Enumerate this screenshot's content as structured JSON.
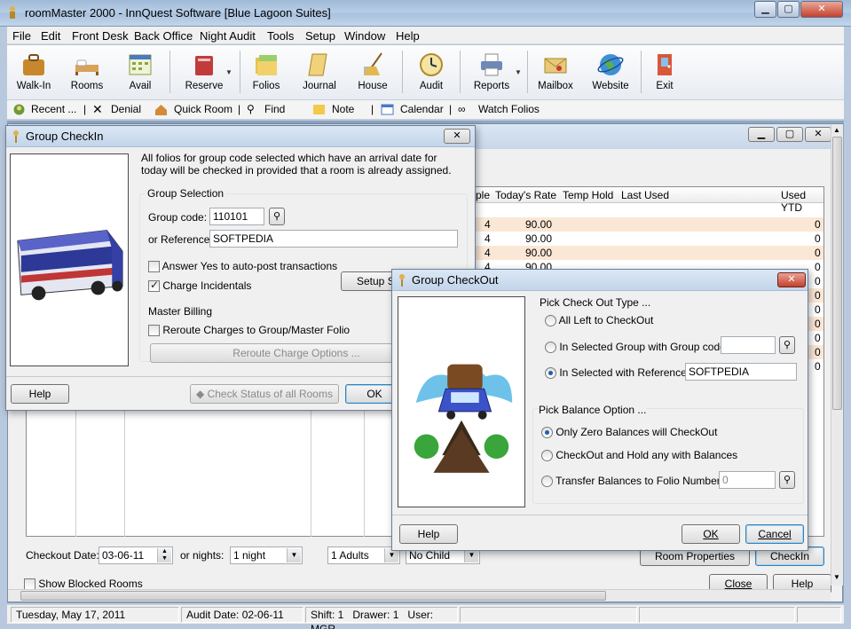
{
  "window": {
    "title": "roomMaster 2000 - InnQuest Software [Blue Lagoon Suites]"
  },
  "menu": [
    "File",
    "Edit",
    "Front Desk",
    "Back Office",
    "Night Audit",
    "Tools",
    "Setup",
    "Window",
    "Help"
  ],
  "toolbar": {
    "walkin": "Walk-In",
    "rooms": "Rooms",
    "avail": "Avail",
    "reserve": "Reserve",
    "folios": "Folios",
    "journal": "Journal",
    "house": "House",
    "audit": "Audit",
    "reports": "Reports",
    "mailbox": "Mailbox",
    "website": "Website",
    "exit": "Exit"
  },
  "toolbar2": {
    "recent": "Recent ...",
    "denial": "Denial",
    "quickroom": "Quick Room",
    "find": "Find",
    "note": "Note",
    "calendar": "Calendar",
    "watchfolios": "Watch Folios"
  },
  "roomgrid": {
    "headers": {
      "people": "ple",
      "rate": "Today's Rate",
      "hold": "Temp Hold",
      "lastused": "Last Used",
      "usedytd": "Used YTD"
    },
    "rows": [
      {
        "people": "4",
        "rate": "90.00",
        "ytd": "0"
      },
      {
        "people": "4",
        "rate": "90.00",
        "ytd": "0"
      },
      {
        "people": "4",
        "rate": "90.00",
        "ytd": "0"
      },
      {
        "people": "4",
        "rate": "90.00",
        "ytd": "0"
      }
    ],
    "extra_ytd": [
      "0",
      "0",
      "0",
      "0",
      "0",
      "0",
      "0"
    ]
  },
  "bottom": {
    "checkout_date_label": "Checkout Date:",
    "checkout_date": "03-06-11",
    "nights_label": "or nights:",
    "nights": "1 night",
    "adults": "1 Adults",
    "child": "No Child",
    "room_properties": "Room Properties",
    "checkin": "CheckIn",
    "show_blocked": "Show Blocked Rooms",
    "close": "Close",
    "help": "Help"
  },
  "checkin_dialog": {
    "title": "Group CheckIn",
    "info": "All folios for group code selected which have an arrival date for today will be checked in provided that a room is already assigned.",
    "group_selection": "Group Selection",
    "group_code_label": "Group code:",
    "group_code": "110101",
    "reference_label": "or Reference:",
    "reference": "SOFTPEDIA",
    "answer_yes": "Answer Yes to auto-post transactions",
    "charge_incidentals": "Charge Incidentals",
    "setup_btn": "Setup S",
    "master_billing": "Master Billing",
    "reroute_charges": "Reroute Charges to Group/Master Folio",
    "reroute_options": "Reroute Charge Options ...",
    "help": "Help",
    "check_status": "Check Status of all Rooms",
    "ok": "OK",
    "close_glyph": "✕"
  },
  "checkout_dialog": {
    "title": "Group CheckOut",
    "pick_type": "Pick Check Out Type ...",
    "all_left": "All Left to CheckOut",
    "in_group": "In Selected Group with Group code:",
    "group_code": "",
    "in_reference": "In Selected with Reference",
    "reference": "SOFTPEDIA",
    "pick_balance": "Pick Balance Option ...",
    "only_zero": "Only Zero Balances will CheckOut",
    "hold_any": "CheckOut and Hold any with Balances",
    "transfer": "Transfer Balances to Folio Number:",
    "folio_number": "0",
    "help": "Help",
    "ok": "OK",
    "cancel": "Cancel",
    "close_glyph": "✕"
  },
  "status": {
    "date": "Tuesday, May 17, 2011",
    "audit": "Audit Date: 02-06-11",
    "shift": "Shift: 1",
    "drawer": "Drawer: 1",
    "user": "User: MGR"
  },
  "colors": {
    "accent": "#1c5fb2",
    "row_highlight": "#fbe7d5",
    "titlebar": "#b6cde6"
  }
}
